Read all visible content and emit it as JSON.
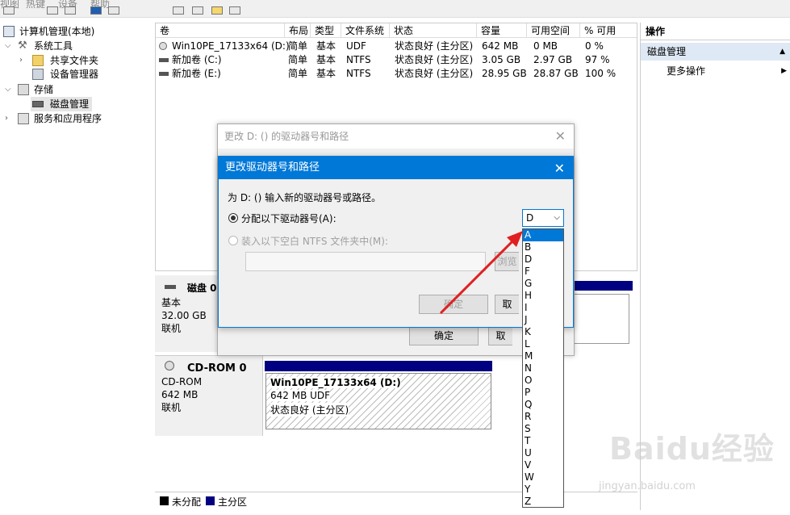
{
  "menubar": {
    "items": [
      "视图",
      "帮助"
    ],
    "faded_items": [
      "热键",
      "设备"
    ]
  },
  "tree": {
    "root": "计算机管理(本地)",
    "system_tools": "系统工具",
    "shared_folders": "共享文件夹",
    "device_manager": "设备管理器",
    "storage": "存储",
    "disk_management": "磁盘管理",
    "services": "服务和应用程序"
  },
  "volume_table": {
    "headers": [
      "卷",
      "布局",
      "类型",
      "文件系统",
      "状态",
      "容量",
      "可用空间",
      "% 可用"
    ],
    "rows": [
      [
        "Win10PE_17133x64 (D:)",
        "简单",
        "基本",
        "UDF",
        "状态良好 (主分区)",
        "642 MB",
        "0 MB",
        "0 %"
      ],
      [
        "新加卷 (C:)",
        "简单",
        "基本",
        "NTFS",
        "状态良好 (主分区)",
        "3.05 GB",
        "2.97 GB",
        "97 %"
      ],
      [
        "新加卷 (E:)",
        "简单",
        "基本",
        "NTFS",
        "状态良好 (主分区)",
        "28.95 GB",
        "28.87 GB",
        "100 %"
      ]
    ]
  },
  "disks": {
    "disk0": {
      "name": "磁盘 0",
      "type": "基本",
      "size": "32.00 GB",
      "status": "联机"
    },
    "cdrom0": {
      "name": "CD-ROM 0",
      "type": "CD-ROM",
      "size": "642 MB",
      "status": "联机",
      "volume_name": "Win10PE_17133x64  (D:)",
      "volume_fs": "642 MB UDF",
      "volume_status": "状态良好 (主分区)"
    }
  },
  "legend": {
    "unallocated": "未分配",
    "primary": "主分区"
  },
  "actions": {
    "title": "操作",
    "section": "磁盘管理",
    "more": "更多操作"
  },
  "outer_dialog": {
    "title": "更改 D: () 的驱动器号和路径",
    "ok": "确定",
    "cancel_partial": "取"
  },
  "inner_dialog": {
    "title": "更改驱动器号和路径",
    "prompt": "为 D: () 输入新的驱动器号或路径。",
    "option_assign": "分配以下驱动器号(A):",
    "option_mount": "装入以下空白 NTFS 文件夹中(M):",
    "browse_partial": "浏览",
    "ok": "确定",
    "cancel_partial": "取",
    "selected_letter": "D"
  },
  "dropdown": {
    "options": [
      "A",
      "B",
      "D",
      "F",
      "G",
      "H",
      "I",
      "J",
      "K",
      "L",
      "M",
      "N",
      "O",
      "P",
      "Q",
      "R",
      "S",
      "T",
      "U",
      "V",
      "W",
      "Y",
      "Z"
    ],
    "highlighted": "A"
  },
  "watermark": {
    "brand": "Baidu经验",
    "url": "jingyan.baidu.com"
  },
  "colors": {
    "accent": "#0078d7",
    "primary_partition": "#000080",
    "unallocated": "#000000",
    "arrow": "#e02020"
  }
}
